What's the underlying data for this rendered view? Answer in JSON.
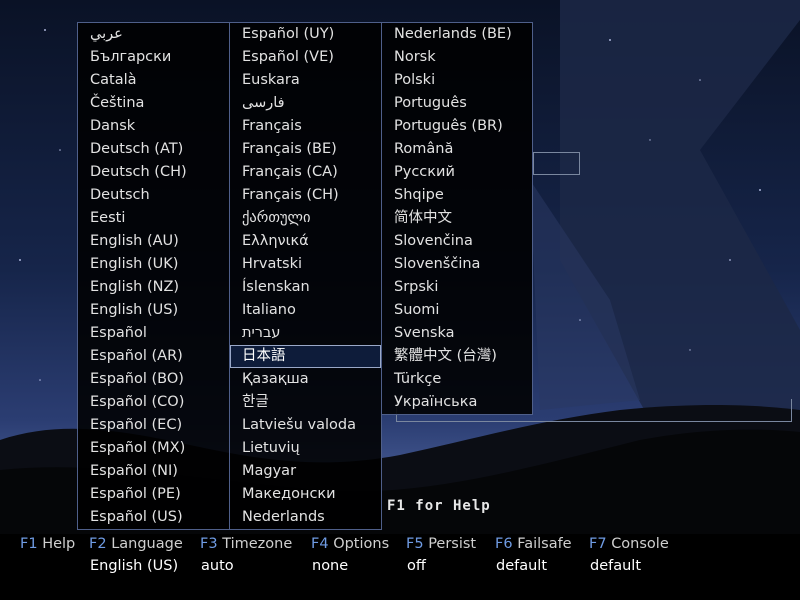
{
  "languages": {
    "column1": [
      "عربي",
      "Български",
      "Català",
      "Čeština",
      "Dansk",
      "Deutsch (AT)",
      "Deutsch (CH)",
      "Deutsch",
      "Eesti",
      "English (AU)",
      "English (UK)",
      "English (NZ)",
      "English (US)",
      "Español",
      "Español (AR)",
      "Español (BO)",
      "Español (CO)",
      "Español (EC)",
      "Español (MX)",
      "Español (NI)",
      "Español (PE)",
      "Español (US)"
    ],
    "column2": [
      "Español (UY)",
      "Español (VE)",
      "Euskara",
      "فارسی",
      "Français",
      "Français (BE)",
      "Français (CA)",
      "Français (CH)",
      "ქართული",
      "Ελληνικά",
      "Hrvatski",
      "Íslenskan",
      "Italiano",
      "עברית",
      "日本語",
      "Қазақша",
      "한글",
      "Latviešu valoda",
      "Lietuvių",
      "Magyar",
      "Македонски",
      "Nederlands"
    ],
    "column3": [
      "Nederlands (BE)",
      "Norsk",
      "Polski",
      "Português",
      "Português (BR)",
      "Română",
      "Русский",
      "Shqipe",
      "简体中文",
      "Slovenčina",
      "Slovenščina",
      "Srpski",
      "Suomi",
      "Svenska",
      "繁體中文 (台灣)",
      "Türkçe",
      "Українська"
    ],
    "selected": "日本語"
  },
  "help_hint": "F1 for Help",
  "menu": {
    "f1": {
      "key": "F1",
      "label": "Help"
    },
    "f2": {
      "key": "F2",
      "label": "Language",
      "value": "English (US)"
    },
    "f3": {
      "key": "F3",
      "label": "Timezone",
      "value": "auto"
    },
    "f4": {
      "key": "F4",
      "label": "Options",
      "value": "none"
    },
    "f5": {
      "key": "F5",
      "label": "Persist",
      "value": "off"
    },
    "f6": {
      "key": "F6",
      "label": "Failsafe",
      "value": "default"
    },
    "f7": {
      "key": "F7",
      "label": "Console",
      "value": "default"
    }
  },
  "colors": {
    "fkey": "#6f9be3",
    "panel_border": "#4f5f8a",
    "selected_bg": "#0e1c3a"
  }
}
